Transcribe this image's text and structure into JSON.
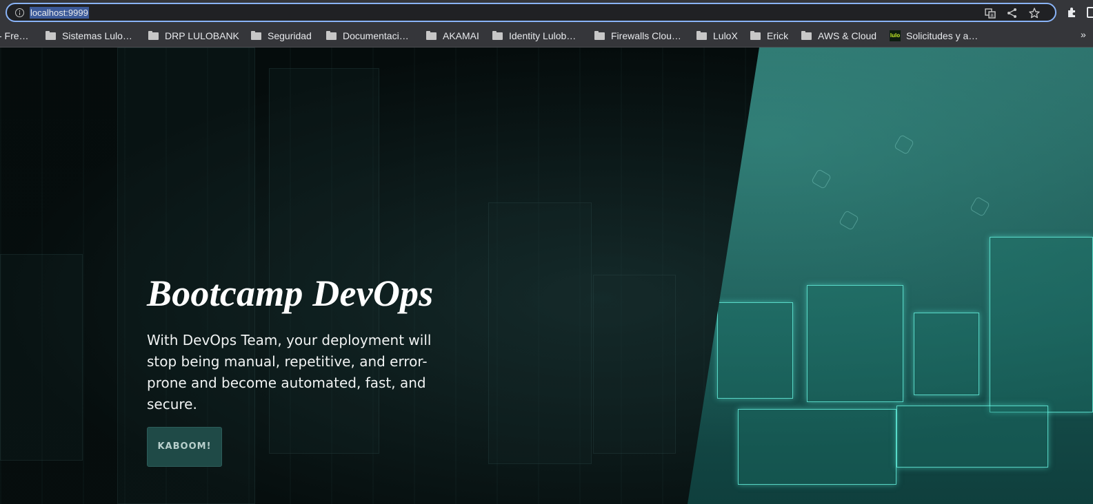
{
  "browser": {
    "url": "localhost:9999",
    "bookmarks": [
      {
        "label": "- Fre…",
        "icon": "none"
      },
      {
        "label": "Sistemas Lulo…",
        "icon": "folder-icon"
      },
      {
        "label": "DRP LULOBANK",
        "icon": "folder-icon"
      },
      {
        "label": "Seguridad",
        "icon": "folder-icon"
      },
      {
        "label": "Documentaci…",
        "icon": "folder-icon"
      },
      {
        "label": "AKAMAI",
        "icon": "folder-icon"
      },
      {
        "label": "Identity Lulob…",
        "icon": "folder-icon"
      },
      {
        "label": "Firewalls Clou…",
        "icon": "folder-icon"
      },
      {
        "label": "LuloX",
        "icon": "folder-icon"
      },
      {
        "label": "Erick",
        "icon": "folder-icon"
      },
      {
        "label": "AWS & Cloud",
        "icon": "folder-icon"
      },
      {
        "label": "Solicitudes y a…",
        "icon": "lulo-favicon",
        "favicon_text": "lulo"
      }
    ],
    "overflow_label": "»"
  },
  "hero": {
    "title": "Bootcamp DevOps",
    "text": "With DevOps Team, your deployment will stop being manual, repetitive, and error-prone and become automated, fast, and secure.",
    "button_label": "KABOOM!"
  },
  "colors": {
    "accent": "#8ab4f8",
    "button_bg": "#1f4a47",
    "teal_panel": "#1f5a56",
    "dark_bg": "#050b0b"
  }
}
